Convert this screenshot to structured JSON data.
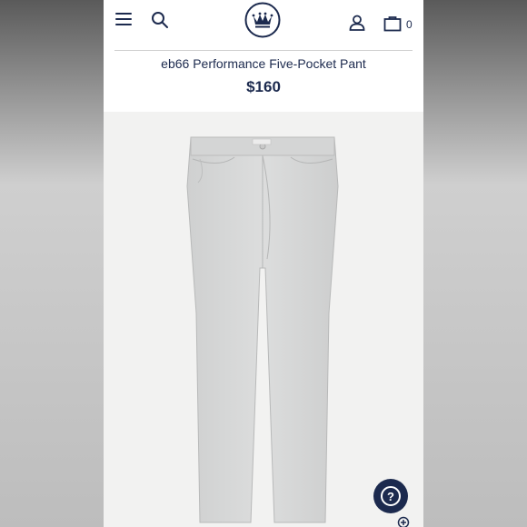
{
  "header": {
    "icons": [
      "menu-icon",
      "search-icon",
      "crown-logo",
      "account-icon",
      "bag-icon"
    ],
    "bag_count": "0"
  },
  "product": {
    "title": "eb66 Performance Five-Pocket Pant",
    "price": "$160",
    "image": "light-grey-five-pocket-pants"
  },
  "help": {
    "icon": "help-icon",
    "label": "?"
  },
  "colors": {
    "brand_navy": "#1c2a4e",
    "product_bg": "#f2f2f1",
    "pants": "#d9dada"
  }
}
